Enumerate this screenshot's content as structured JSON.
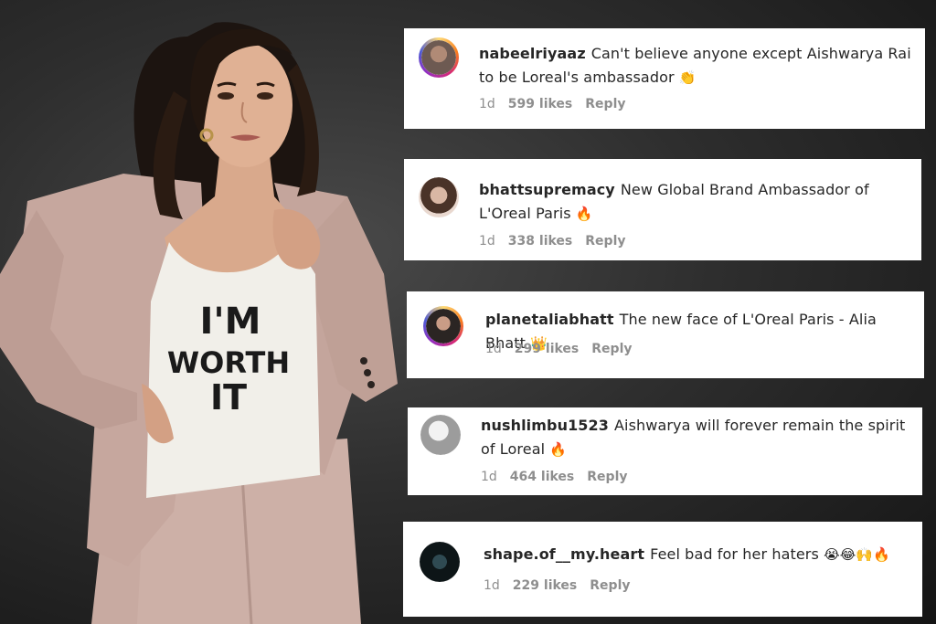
{
  "photo": {
    "shirt_text_line1": "I'M",
    "shirt_text_line2": "WORTH",
    "shirt_text_line3": "IT"
  },
  "comments": [
    {
      "username": "nabeelriyaaz",
      "text": "Can't believe anyone except Aishwarya Rai to be Loreal's ambassador",
      "emoji": "👏",
      "age": "1d",
      "likes": "599 likes",
      "reply": "Reply",
      "avatar_ring": true
    },
    {
      "username": "bhattsupremacy",
      "text": "New Global Brand Ambassador of L'Oreal Paris",
      "emoji": "🔥",
      "age": "1d",
      "likes": "338 likes",
      "reply": "Reply",
      "avatar_ring": false
    },
    {
      "username": "planetaliabhatt",
      "text": "The new face of L'Oreal Paris - Alia Bhatt",
      "emoji": "👑",
      "age": "1d",
      "likes": "299 likes",
      "reply": "Reply",
      "avatar_ring": true
    },
    {
      "username": "nushlimbu1523",
      "text": "Aishwarya will forever remain the spirit of Loreal",
      "emoji": "🔥",
      "age": "1d",
      "likes": "464 likes",
      "reply": "Reply",
      "avatar_ring": false
    },
    {
      "username": "shape.of__my.heart",
      "text": "Feel bad for her haters",
      "emoji": "😭😂🙌🔥",
      "age": "1d",
      "likes": "229 likes",
      "reply": "Reply",
      "avatar_ring": false
    }
  ],
  "colors": {
    "card_bg": "#ffffff",
    "text": "#262626",
    "meta": "#8e8e8e",
    "jacket": "#c9aca4",
    "tank": "#f1efe9"
  }
}
